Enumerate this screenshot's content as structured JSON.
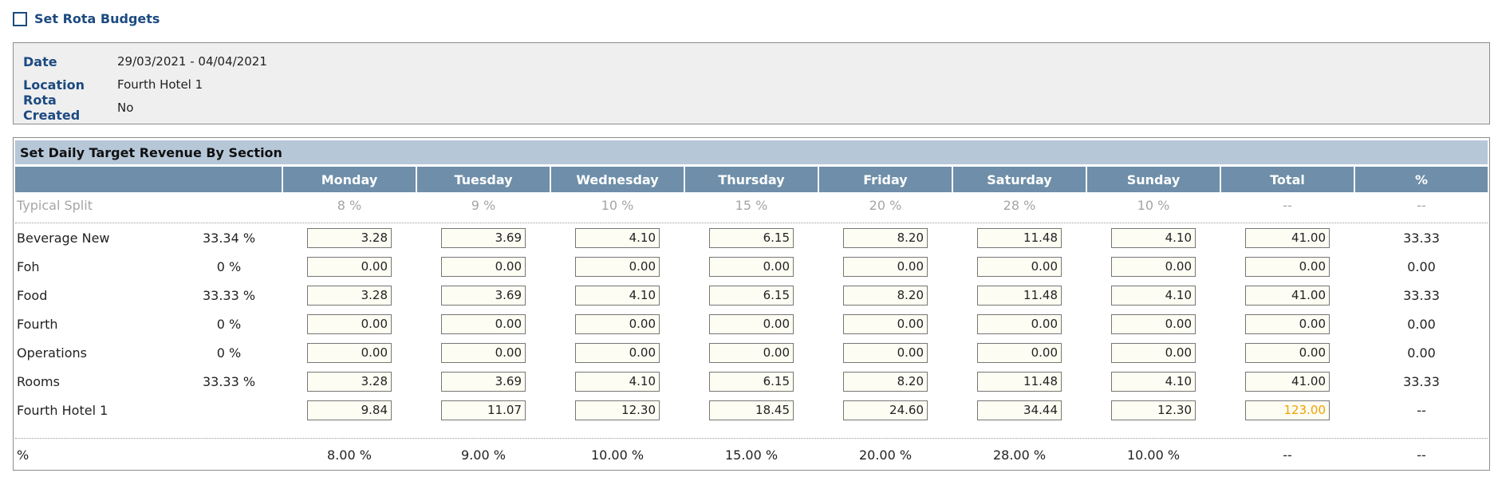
{
  "page": {
    "title": "Set Rota Budgets"
  },
  "info": {
    "date_label": "Date",
    "date_value": "29/03/2021 - 04/04/2021",
    "location_label": "Location",
    "location_value": "Fourth Hotel 1",
    "rota_label": "Rota Created",
    "rota_value": "No"
  },
  "panel": {
    "title": "Set Daily Target Revenue By Section",
    "columns": [
      "Monday",
      "Tuesday",
      "Wednesday",
      "Thursday",
      "Friday",
      "Saturday",
      "Sunday",
      "Total",
      "%"
    ],
    "typical_split": {
      "label": "Typical Split",
      "values": [
        "8 %",
        "9 %",
        "10 %",
        "15 %",
        "20 %",
        "28 %",
        "10 %",
        "--",
        "--"
      ]
    },
    "rows": [
      {
        "name": "Beverage New",
        "pct": "33.34 %",
        "values": [
          "3.28",
          "3.69",
          "4.10",
          "6.15",
          "8.20",
          "11.48",
          "4.10"
        ],
        "total": "41.00",
        "share": "33.33"
      },
      {
        "name": "Foh",
        "pct": "0 %",
        "values": [
          "0.00",
          "0.00",
          "0.00",
          "0.00",
          "0.00",
          "0.00",
          "0.00"
        ],
        "total": "0.00",
        "share": "0.00"
      },
      {
        "name": "Food",
        "pct": "33.33 %",
        "values": [
          "3.28",
          "3.69",
          "4.10",
          "6.15",
          "8.20",
          "11.48",
          "4.10"
        ],
        "total": "41.00",
        "share": "33.33"
      },
      {
        "name": "Fourth",
        "pct": "0 %",
        "values": [
          "0.00",
          "0.00",
          "0.00",
          "0.00",
          "0.00",
          "0.00",
          "0.00"
        ],
        "total": "0.00",
        "share": "0.00"
      },
      {
        "name": "Operations",
        "pct": "0 %",
        "values": [
          "0.00",
          "0.00",
          "0.00",
          "0.00",
          "0.00",
          "0.00",
          "0.00"
        ],
        "total": "0.00",
        "share": "0.00"
      },
      {
        "name": "Rooms",
        "pct": "33.33 %",
        "values": [
          "3.28",
          "3.69",
          "4.10",
          "6.15",
          "8.20",
          "11.48",
          "4.10"
        ],
        "total": "41.00",
        "share": "33.33"
      },
      {
        "name": "Fourth Hotel 1",
        "pct": "",
        "values": [
          "9.84",
          "11.07",
          "12.30",
          "18.45",
          "24.60",
          "34.44",
          "12.30"
        ],
        "total": "123.00",
        "share": "--"
      }
    ],
    "footer": {
      "label": "%",
      "values": [
        "8.00 %",
        "9.00 %",
        "10.00 %",
        "15.00 %",
        "20.00 %",
        "28.00 %",
        "10.00 %",
        "--",
        "--"
      ]
    }
  },
  "colors": {
    "accent": "#1c4a80",
    "header_bg": "#6e8ea9",
    "panel_header_bg": "#b6c7d8",
    "total_highlight": "#f0a200"
  }
}
